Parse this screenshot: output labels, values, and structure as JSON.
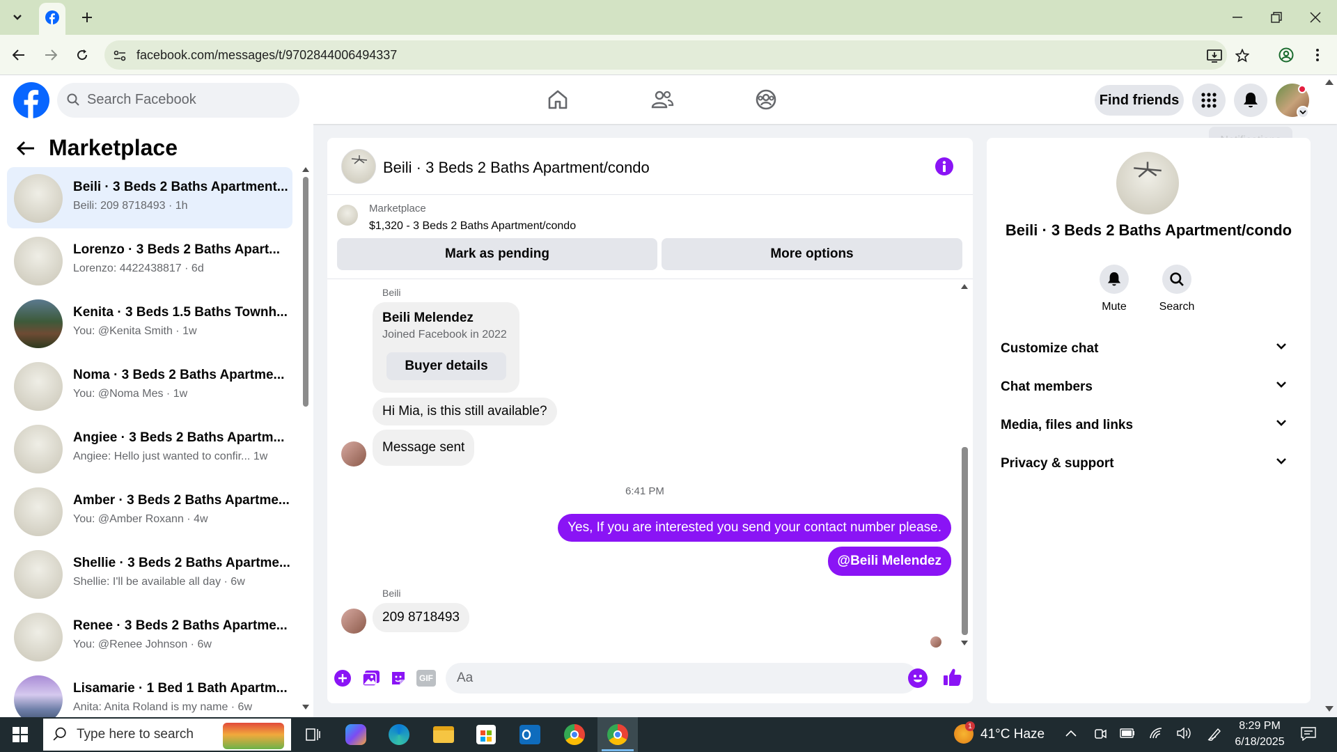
{
  "browser": {
    "url": "facebook.com/messages/t/9702844006494337"
  },
  "header": {
    "search_placeholder": "Search Facebook",
    "find_friends": "Find friends",
    "tooltip": "Notifications"
  },
  "sidebar": {
    "title": "Marketplace",
    "conversations": [
      {
        "title": "Beili · 3 Beds 2 Baths Apartment...",
        "sub": "Beili: 209 8718493 · 1h",
        "selected": true
      },
      {
        "title": "Lorenzo · 3 Beds 2 Baths Apart...",
        "sub": "Lorenzo: 4422438817 · 6d"
      },
      {
        "title": "Kenita · 3 Beds 1.5 Baths Townh...",
        "sub": "You: @Kenita Smith · 1w"
      },
      {
        "title": "Noma · 3 Beds 2 Baths Apartme...",
        "sub": "You: @Noma Mes · 1w"
      },
      {
        "title": "Angiee · 3 Beds 2 Baths Apartm...",
        "sub": "Angiee: Hello just wanted to confir...   1w"
      },
      {
        "title": "Amber · 3 Beds 2 Baths Apartme...",
        "sub": "You: @Amber Roxann · 4w"
      },
      {
        "title": "Shellie · 3 Beds 2 Baths Apartme...",
        "sub": "Shellie: I'll be available all day · 6w"
      },
      {
        "title": "Renee · 3 Beds 2 Baths Apartme...",
        "sub": "You: @Renee Johnson · 6w"
      },
      {
        "title": "Lisamarie · 1 Bed 1 Bath Apartm...",
        "sub": "Anita: Anita Roland is my name · 6w"
      }
    ]
  },
  "chat": {
    "title": "Beili · 3 Beds 2 Baths Apartment/condo",
    "listing_source": "Marketplace",
    "listing_price": "$1,320 - 3 Beds 2 Baths Apartment/condo",
    "mark_pending": "Mark as pending",
    "more_options": "More options",
    "sender_label": "Beili",
    "card_name": "Beili Melendez",
    "card_joined": "Joined Facebook in 2022",
    "card_button": "Buyer details",
    "msg1": "Hi Mia, is this still available?",
    "msg2": "Message sent",
    "timestamp": "6:41 PM",
    "msg3": "Yes, If you are interested you send your contact number please.",
    "msg4": "@Beili Melendez",
    "sender_label2": "Beili",
    "msg5": "209 8718493",
    "composer_placeholder": "Aa",
    "gif_label": "GIF"
  },
  "info": {
    "title": "Beili · 3 Beds 2 Baths Apartment/condo",
    "mute": "Mute",
    "search": "Search",
    "sections": [
      "Customize chat",
      "Chat members",
      "Media, files and links",
      "Privacy & support"
    ]
  },
  "taskbar": {
    "search_placeholder": "Type here to search",
    "weather": "41°C  Haze",
    "weather_badge": "1",
    "time": "8:29 PM",
    "date": "6/18/2025"
  },
  "colors": {
    "accent": "#8a14f5",
    "facebook_blue": "#0866ff"
  }
}
